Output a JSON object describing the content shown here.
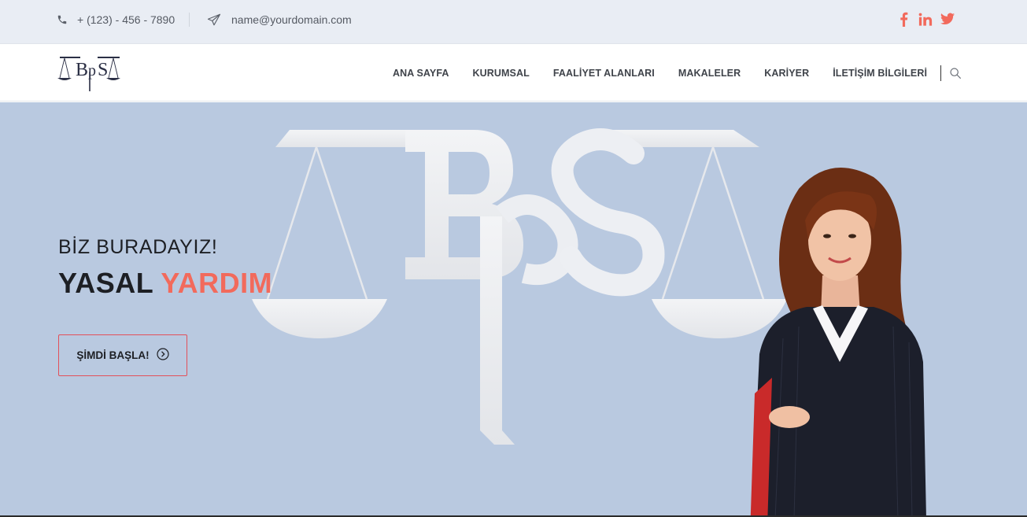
{
  "topbar": {
    "phone": "+ (123) - 456 - 7890",
    "email": "name@yourdomain.com",
    "social": [
      "facebook-icon",
      "linkedin-icon",
      "twitter-icon"
    ],
    "social_color": "#f26a5c"
  },
  "brand": {
    "logo_text": "BpS"
  },
  "nav": {
    "items": [
      {
        "label": "ANA SAYFA"
      },
      {
        "label": "KURUMSAL"
      },
      {
        "label": "FAALİYET ALANLARI"
      },
      {
        "label": "MAKALELER"
      },
      {
        "label": "KARİYER"
      },
      {
        "label": "İLETİŞİM BİLGİLERİ"
      }
    ]
  },
  "hero": {
    "eyebrow": "BİZ BURADAYIZ!",
    "title_main": "YASAL",
    "title_accent": "YARDIM",
    "cta_label": "ŞİMDİ BAŞLA!",
    "accent_color": "#f26a5c",
    "background_color": "#b9c9e0"
  }
}
